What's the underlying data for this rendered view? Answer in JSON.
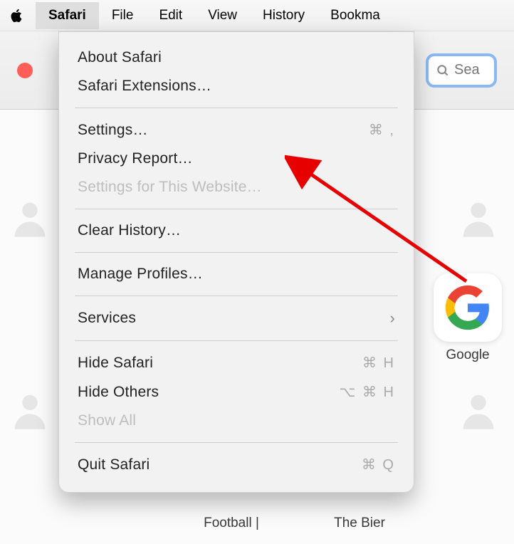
{
  "menubar": {
    "items": [
      "Safari",
      "File",
      "Edit",
      "View",
      "History",
      "Bookma"
    ]
  },
  "search": {
    "placeholder": "Sea"
  },
  "dropdown": {
    "about": "About Safari",
    "extensions": "Safari Extensions…",
    "settings": "Settings…",
    "settings_shortcut": "⌘ ,",
    "privacy_report": "Privacy Report…",
    "settings_website": "Settings for This Website…",
    "clear_history": "Clear History…",
    "manage_profiles": "Manage Profiles…",
    "services": "Services",
    "hide_safari": "Hide Safari",
    "hide_safari_shortcut": "⌘ H",
    "hide_others": "Hide Others",
    "hide_others_shortcut": "⌥ ⌘ H",
    "show_all": "Show All",
    "quit": "Quit Safari",
    "quit_shortcut": "⌘ Q"
  },
  "tiles": {
    "google": "Google",
    "football": "Football |",
    "bier": "The Bier"
  }
}
